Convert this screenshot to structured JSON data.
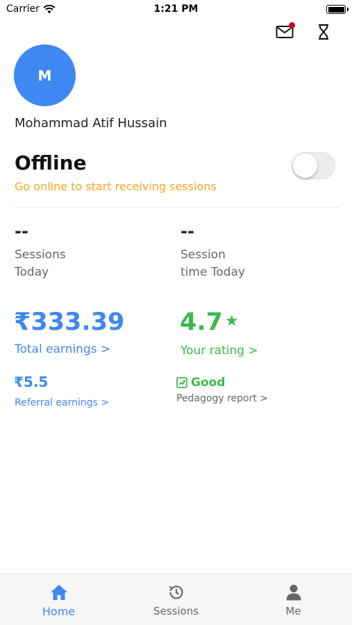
{
  "status_bar": {
    "carrier": "Carrier",
    "time": "1:21 PM"
  },
  "profile": {
    "initial": "M",
    "name": "Mohammad Atif Hussain"
  },
  "availability": {
    "title": "Offline",
    "subtitle": "Go online to start receiving sessions",
    "online": false
  },
  "stats": {
    "sessions_today": {
      "value": "--",
      "label_line1": "Sessions",
      "label_line2": "Today"
    },
    "session_time_today": {
      "value": "--",
      "label_line1": "Session",
      "label_line2": "time Today"
    }
  },
  "earnings": {
    "total_value": "₹333.39",
    "total_label": "Total earnings >",
    "referral_value": "₹5.5",
    "referral_label": "Referral earnings >"
  },
  "rating": {
    "value": "4.7",
    "star": "★",
    "label": "Your rating >"
  },
  "pedagogy": {
    "value": "Good",
    "label": "Pedagogy report >"
  },
  "tabs": [
    {
      "label": "Home",
      "icon": "home-icon",
      "active": true
    },
    {
      "label": "Sessions",
      "icon": "history-icon",
      "active": false
    },
    {
      "label": "Me",
      "icon": "person-icon",
      "active": false
    }
  ],
  "colors": {
    "accent_blue": "#3f88f2",
    "green": "#3db94a",
    "orange": "#f5a623",
    "notification_red": "#d0021b"
  }
}
